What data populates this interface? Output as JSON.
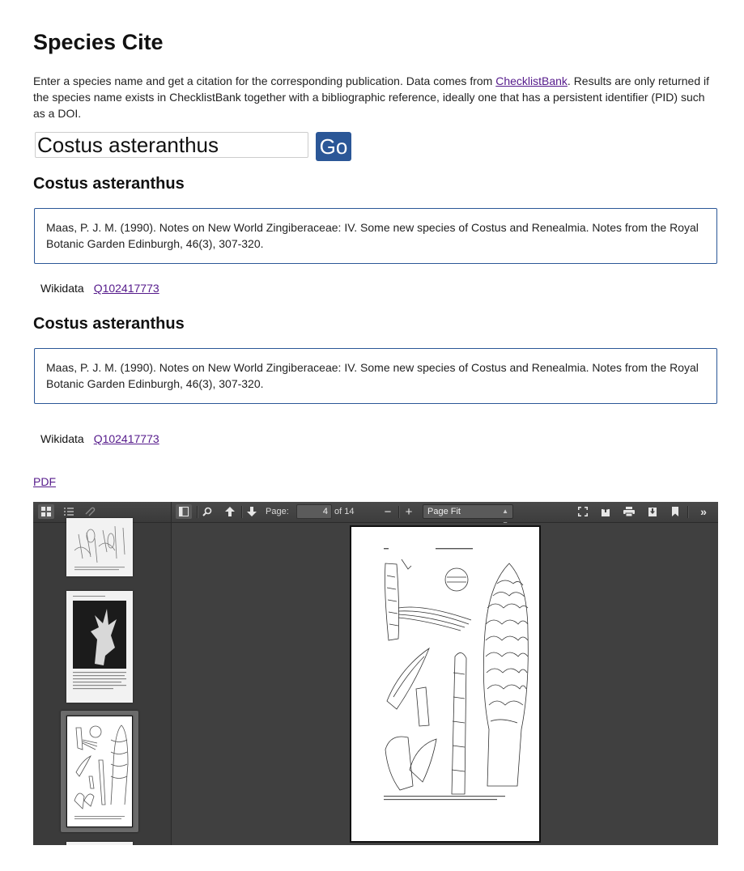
{
  "header": {
    "title": "Species Cite"
  },
  "intro": {
    "text_before": "Enter a species name and get a citation for the corresponding publication. Data comes from ",
    "link_label": "ChecklistBank",
    "text_after": ". Results are only returned if the species name exists in ChecklistBank together with a bibliographic reference, ideally one that has a persistent identifier (PID) such as a DOI."
  },
  "search": {
    "value": "Costus asteranthus",
    "button_label": "Go"
  },
  "results": [
    {
      "title": "Costus asteranthus",
      "citation": "Maas, P. J. M. (1990). Notes on New World Zingiberaceae: IV. Some new species of Costus and Renealmia. Notes from the Royal Botanic Garden Edinburgh, 46(3), 307-320.",
      "id_label": "Wikidata",
      "id_value": "Q102417773"
    },
    {
      "title": "Costus asteranthus",
      "citation": "Maas, P. J. M. (1990). Notes on New World Zingiberaceae: IV. Some new species of Costus and Renealmia. Notes from the Royal Botanic Garden Edinburgh, 46(3), 307-320.",
      "id_label": "Wikidata",
      "id_value": "Q102417773"
    }
  ],
  "pdf_link": "PDF",
  "viewer": {
    "page_label": "Page:",
    "page_number": "4",
    "page_of": "of 14",
    "zoom_minus": "−",
    "zoom_plus": "+",
    "zoom_value": "Page Fit",
    "icons": [
      "thumbnails-icon",
      "outline-icon",
      "attachments-icon",
      "sidebar-toggle-icon",
      "find-icon",
      "previous-page-icon",
      "next-page-icon",
      "zoom-out-icon",
      "zoom-in-icon",
      "presentation-mode-icon",
      "open-file-icon",
      "print-icon",
      "download-icon",
      "bookmark-icon",
      "tools-icon"
    ]
  }
}
